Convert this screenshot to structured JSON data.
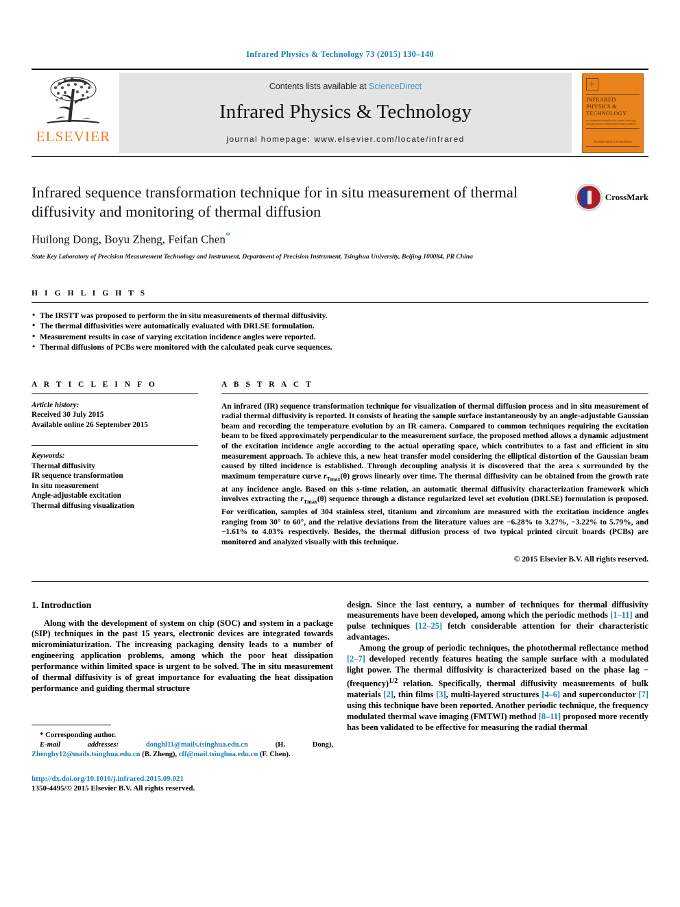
{
  "running_head": "Infrared Physics & Technology 73 (2015) 130–140",
  "masthead": {
    "publisher_word": "ELSEVIER",
    "contents_prefix": "Contents lists available at ",
    "contents_link": "ScienceDirect",
    "journal_title": "Infrared Physics & Technology",
    "homepage": "journal homepage: www.elsevier.com/locate/infrared",
    "cover": {
      "title": "Infrared Physics & Technology",
      "subtitle": "an international journal for the science, technology and applications of infrared and terahertz radiation",
      "footer": "Available online at\nScienceDirect"
    }
  },
  "article": {
    "title": "Infrared sequence transformation technique for in situ measurement of thermal diffusivity and monitoring of thermal diffusion",
    "authors": "Huilong Dong, Boyu Zheng, Feifan Chen",
    "corresponding_marker": "*",
    "affiliation": "State Key Laboratory of Precision Measurement Technology and Instrument, Department of Precision Instrument, Tsinghua University, Beijing 100084, PR China",
    "crossmark_label": "CrossMark"
  },
  "highlights": {
    "heading": "H I G H L I G H T S",
    "items": [
      "The IRSTT was proposed to perform the in situ measurements of thermal diffusivity.",
      "The thermal diffusivities were automatically evaluated with DRLSE formulation.",
      "Measurement results in case of varying excitation incidence angles were reported.",
      "Thermal diffusions of PCBs were monitored with the calculated peak curve sequences."
    ]
  },
  "article_info": {
    "heading": "A R T I C L E    I N F O",
    "history_label": "Article history:",
    "history": [
      "Received 30 July 2015",
      "Available online 26 September 2015"
    ],
    "keywords_label": "Keywords:",
    "keywords": [
      "Thermal diffusivity",
      "IR sequence transformation",
      "In situ measurement",
      "Angle-adjustable excitation",
      "Thermal diffusing visualization"
    ]
  },
  "abstract": {
    "heading": "A B S T R A C T",
    "part1": "An infrared (IR) sequence transformation technique for visualization of thermal diffusion process and in situ measurement of radial thermal diffusivity is reported. It consists of heating the sample surface instantaneously by an angle-adjustable Gaussian beam and recording the temperature evolution by an IR camera. Compared to common techniques requiring the excitation beam to be fixed approximately perpendicular to the measurement surface, the proposed method allows a dynamic adjustment of the excitation incidence angle according to the actual operating space, which contributes to a fast and efficient in situ measurement approach. To achieve this, a new heat transfer model considering the elliptical distortion of the Gaussian beam caused by tilted incidence is established. Through decoupling analysis it is discovered that the area s surrounded by the maximum temperature curve ",
    "sym1_base": "r",
    "sym1_sub": "Tmax",
    "sym1_arg": "(θ)",
    "part2": " grows linearly over time. The thermal diffusivity can be obtained from the growth rate at any incidence angle. Based on this s-time relation, an automatic thermal diffusivity characterization framework which involves extracting the ",
    "sym2_base": "r",
    "sym2_sub": "Tmax",
    "sym2_arg": "(θ)",
    "part3": " sequence through a distance regularized level set evolution (DRLSE) formulation is proposed. For verification, samples of 304 stainless steel, titanium and zirconium are measured with the excitation incidence angles ranging from 30° to 60°, and the relative deviations from the literature values are −6.28% to 3.27%, −3.22% to 5.79%, and −1.61% to 4.03% respectively. Besides, the thermal diffusion process of two typical printed circuit boards (PCBs) are monitored and analyzed visually with this technique.",
    "copyright": "© 2015 Elsevier B.V. All rights reserved."
  },
  "body": {
    "section_number_title": "1. Introduction",
    "left_para": "Along with the development of system on chip (SOC) and system in a package (SIP) techniques in the past 15 years, electronic devices are integrated towards microminiaturization. The increasing packaging density leads to a number of engineering application problems, among which the poor heat dissipation performance within limited space is urgent to be solved. The in situ measurement of thermal diffusivity is of great importance for evaluating the heat dissipation performance and guiding thermal structure",
    "right_para1_a": "design. Since the last century, a number of techniques for thermal diffusivity measurements have been developed, among which the periodic methods ",
    "right_para1_ref1": "[1–11]",
    "right_para1_b": " and pulse techniques ",
    "right_para1_ref2": "[12–25]",
    "right_para1_c": " fetch considerable attention for their characteristic advantages.",
    "right_para2_a": "Among the group of periodic techniques, the photothermal reflectance method ",
    "right_para2_ref1": "[2–7]",
    "right_para2_b": " developed recently features heating the sample surface with a modulated light power. The thermal diffusivity is characterized based on the phase lag − (frequency)",
    "right_para2_exp": "1/2",
    "right_para2_c": " relation. Specifically, thermal diffusivity measurements of bulk materials ",
    "right_para2_ref2": "[2]",
    "right_para2_d": ", thin films ",
    "right_para2_ref3": "[3]",
    "right_para2_e": ", multi-layered structures ",
    "right_para2_ref4": "[4–6]",
    "right_para2_f": " and superconductor ",
    "right_para2_ref5": "[7]",
    "right_para2_g": " using this technique have been reported. Another periodic technique, the frequency modulated thermal wave imaging (FMTWI) method ",
    "right_para2_ref6": "[8–11]",
    "right_para2_h": " proposed more recently has been validated to be effective for measuring the radial thermal"
  },
  "footnote": {
    "corresponding_star": "*",
    "corresponding_text": " Corresponding author.",
    "email_label": "E-mail addresses:",
    "email1": "donghl11@mails.tsinghua.edu.cn",
    "email1_owner": " (H. Dong), ",
    "email2": "Zhengby12@mails.tsinghua.edu.cn",
    "email2_owner": " (B. Zheng), ",
    "email3": "cff@mail.tsinghua.edu.cn",
    "email3_owner": " (F. Chen).",
    "doi": "http://dx.doi.org/10.1016/j.infrared.2015.09.021",
    "issn_line": "1350-4495/© 2015 Elsevier B.V. All rights reserved."
  },
  "colors": {
    "link_blue": "#1a7fb5",
    "elsevier_orange": "#f47920",
    "sciencedirect_blue": "#3a8fc8",
    "cover_orange": "#e8821a"
  }
}
